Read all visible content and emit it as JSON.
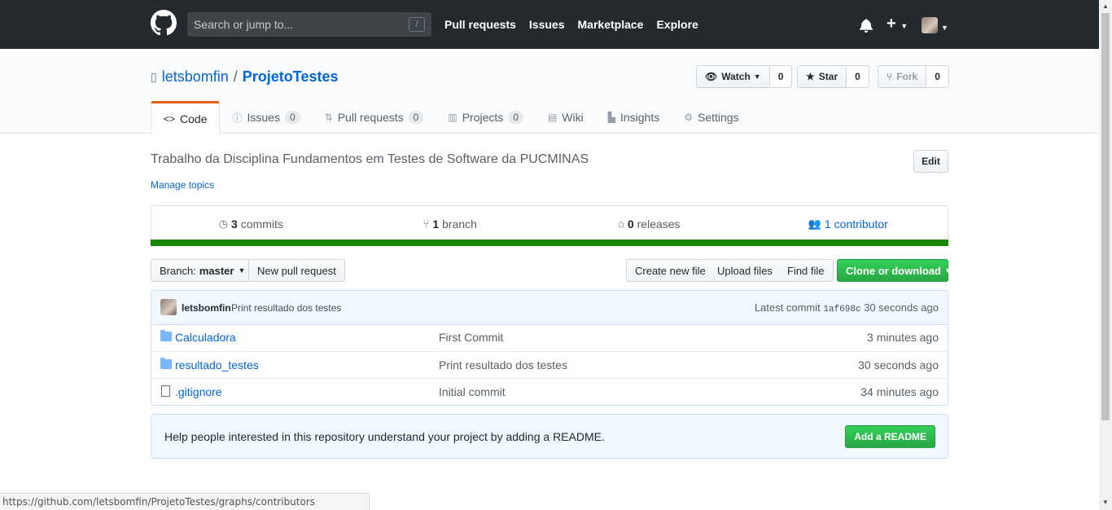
{
  "header": {
    "search_placeholder": "Search or jump to...",
    "search_key": "/",
    "nav": [
      "Pull requests",
      "Issues",
      "Marketplace",
      "Explore"
    ],
    "plus": "+"
  },
  "repo": {
    "owner": "letsbomfin",
    "separator": "/",
    "name": "ProjetoTestes",
    "watch_label": "Watch",
    "watch_count": "0",
    "star_label": "Star",
    "star_count": "0",
    "fork_label": "Fork",
    "fork_count": "0"
  },
  "tabs": [
    {
      "label": "Code",
      "counter": null
    },
    {
      "label": "Issues",
      "counter": "0"
    },
    {
      "label": "Pull requests",
      "counter": "0"
    },
    {
      "label": "Projects",
      "counter": "0"
    },
    {
      "label": "Wiki",
      "counter": null
    },
    {
      "label": "Insights",
      "counter": null
    },
    {
      "label": "Settings",
      "counter": null
    }
  ],
  "description": "Trabalho da Disciplina Fundamentos em Testes de Software da PUCMINAS",
  "edit_label": "Edit",
  "manage_topics": "Manage topics",
  "summary": {
    "commits_num": "3",
    "commits_label": "commits",
    "branch_num": "1",
    "branch_label": "branch",
    "releases_num": "0",
    "releases_label": "releases",
    "contributor_num": "1",
    "contributor_label": "contributor"
  },
  "language_color": "#178600",
  "file_nav": {
    "branch_prefix": "Branch:",
    "branch_name": "master",
    "new_pr": "New pull request",
    "create_file": "Create new file",
    "upload_files": "Upload files",
    "find_file": "Find file",
    "clone": "Clone or download"
  },
  "latest_commit": {
    "author": "letsbomfin",
    "message": "Print resultado dos testes",
    "prefix": "Latest commit",
    "sha": "1af698c",
    "age": "30 seconds ago"
  },
  "files": [
    {
      "type": "folder",
      "name": "Calculadora",
      "message": "First Commit",
      "age": "3 minutes ago"
    },
    {
      "type": "folder",
      "name": "resultado_testes",
      "message": "Print resultado dos testes",
      "age": "30 seconds ago"
    },
    {
      "type": "file",
      "name": ".gitignore",
      "message": "Initial commit",
      "age": "34 minutes ago"
    }
  ],
  "readme": {
    "message": "Help people interested in this repository understand your project by adding a README.",
    "button": "Add a README"
  },
  "status_url": "https://github.com/letsbomfin/ProjetoTestes/graphs/contributors"
}
